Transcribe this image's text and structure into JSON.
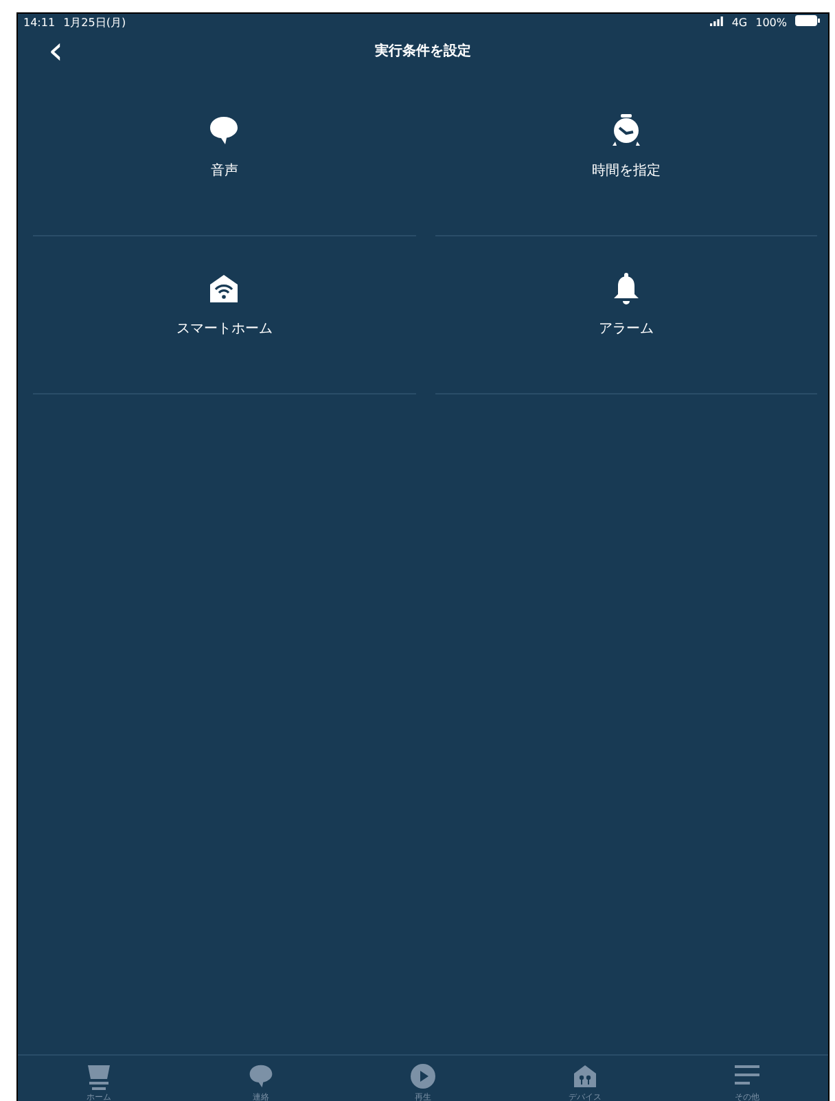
{
  "status_bar": {
    "time": "14:11",
    "date": "1月25日(月)",
    "network": "4G",
    "battery": "100%"
  },
  "header": {
    "back": "‹",
    "title": "実行条件を設定"
  },
  "options": [
    {
      "kind": "voice",
      "label": "音声"
    },
    {
      "kind": "time",
      "label": "時間を指定"
    },
    {
      "kind": "smarthome",
      "label": "スマートホーム"
    },
    {
      "kind": "alarm",
      "label": "アラーム"
    }
  ],
  "tab_bar": [
    {
      "kind": "home",
      "label": "ホーム",
      "selected": false
    },
    {
      "kind": "chat",
      "label": "連絡",
      "selected": false
    },
    {
      "kind": "play",
      "label": "再生",
      "selected": false
    },
    {
      "kind": "devices",
      "label": "デバイス",
      "selected": false
    },
    {
      "kind": "more",
      "label": "その他",
      "selected": false
    }
  ]
}
